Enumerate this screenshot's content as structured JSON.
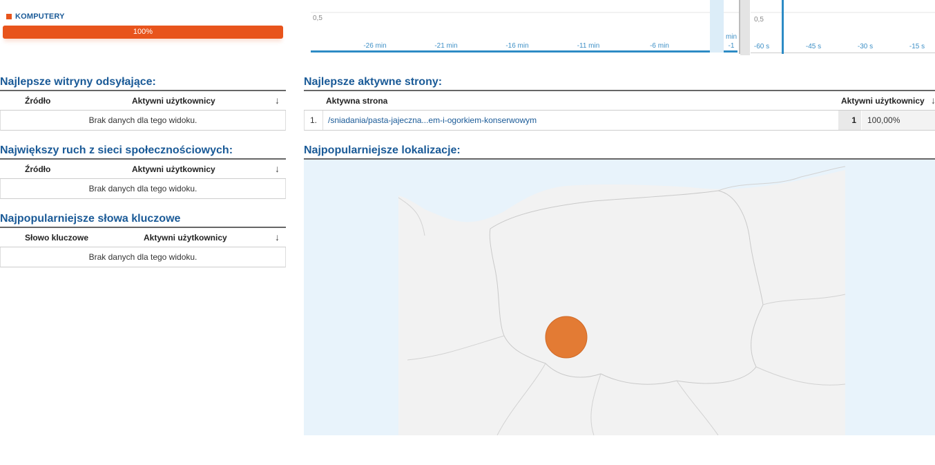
{
  "device": {
    "label": "KOMPUTERY",
    "percent": 100,
    "percent_label": "100%",
    "color": "#e8541c"
  },
  "minutes_chart": {
    "y_label": "0,5",
    "ticks": [
      "-26 min",
      "-21 min",
      "-16 min",
      "-11 min",
      "-6 min"
    ],
    "last_tick_top": "min",
    "last_tick_bottom": "-1"
  },
  "seconds_chart": {
    "y_label": "0,5",
    "ticks": [
      "-60 s",
      "-45 s",
      "-30 s",
      "-15 s"
    ]
  },
  "referrers": {
    "title": "Najlepsze witryny odsyłające:",
    "col_source": "Źródło",
    "col_users": "Aktywni użytkownicy",
    "empty": "Brak danych dla tego widoku."
  },
  "social": {
    "title": "Największy ruch z sieci społecznościowych:",
    "col_source": "Źródło",
    "col_users": "Aktywni użytkownicy",
    "empty": "Brak danych dla tego widoku."
  },
  "keywords": {
    "title": "Najpopularniejsze słowa kluczowe",
    "col_keyword": "Słowo kluczowe",
    "col_users": "Aktywni użytkownicy",
    "empty": "Brak danych dla tego widoku."
  },
  "active_pages": {
    "title": "Najlepsze aktywne strony:",
    "col_page": "Aktywna strona",
    "col_users": "Aktywni użytkownicy",
    "rows": [
      {
        "index": "1.",
        "page": "/sniadania/pasta-jajeczna...em-i-ogorkiem-konserwowym",
        "users": "1",
        "share": "100,00%"
      }
    ]
  },
  "locations": {
    "title": "Najpopularniejsze lokalizacje:",
    "marker_color": "#e37b34"
  }
}
